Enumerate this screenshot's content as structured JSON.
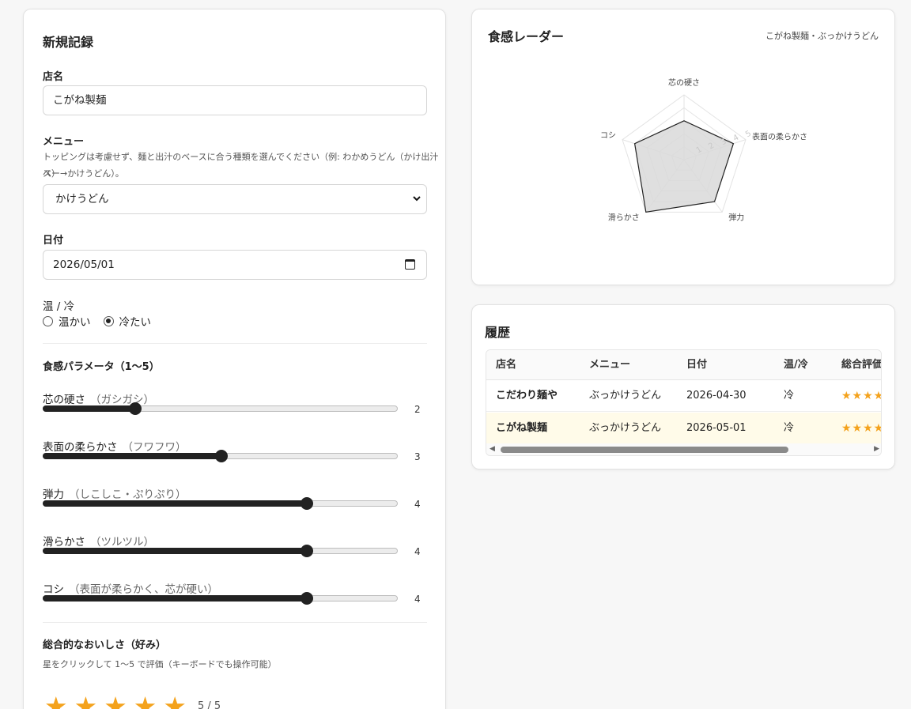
{
  "form": {
    "title": "新規記録",
    "shop_label": "店名",
    "shop_value": "こがね製麺",
    "menu_label": "メニュー",
    "menu_help_line1": "トッピングは考慮せず、麺と出汁のベースに合う種類を選んでください（例: わかめうどん（かけ出汁ベー",
    "menu_help_line2": "ス）→かけうどん）。",
    "menu_value": "かけうどん",
    "date_label": "日付",
    "date_value": "2026/05/01",
    "temp_label": "温 / 冷",
    "temp_options": [
      "温かい",
      "冷たい"
    ],
    "temp_selected": "冷たい",
    "texture_heading": "食感パラメータ（1〜5）",
    "sliders": [
      {
        "label": "芯の硬さ",
        "hint": "（ガシガシ）",
        "value": 2
      },
      {
        "label": "表面の柔らかさ",
        "hint": "（フワフワ）",
        "value": 3
      },
      {
        "label": "弾力",
        "hint": "（しこしこ・ぷりぷり）",
        "value": 4
      },
      {
        "label": "滑らかさ",
        "hint": "（ツルツル）",
        "value": 4
      },
      {
        "label": "コシ",
        "hint": "（表面が柔らかく、芯が硬い）",
        "value": 4
      }
    ],
    "slider_min": 1,
    "slider_max": 5,
    "overall_label": "総合的なおいしさ（好み）",
    "overall_help": "星をクリックして 1〜5 で評価（キーボードでも操作可能）",
    "rating": 5,
    "rating_text": "5 / 5"
  },
  "radar": {
    "title": "食感レーダー",
    "subtitle": "こがね製麺・ぶっかけうどん",
    "axes": [
      "芯の硬さ",
      "表面の柔らかさ",
      "弾力",
      "滑らかさ",
      "コシ"
    ],
    "values": [
      3,
      4,
      4,
      5,
      4
    ],
    "max": 5,
    "tick_labels": [
      "1",
      "2",
      "3",
      "4",
      "5"
    ],
    "fill_color": "#d9d9d9",
    "stroke_color": "#222222"
  },
  "history": {
    "title": "履歴",
    "columns": [
      "店名",
      "メニュー",
      "日付",
      "温/冷",
      "総合評価"
    ],
    "rows": [
      {
        "shop": "こだわり麺や",
        "menu": "ぶっかけうどん",
        "date": "2026-04-30",
        "temp": "冷",
        "stars": "★★★★"
      },
      {
        "shop": "こがね製麺",
        "menu": "ぶっかけうどん",
        "date": "2026-05-01",
        "temp": "冷",
        "stars": "★★★★"
      }
    ]
  },
  "colors": {
    "star": "#f4a21c",
    "highlight_row": "#fffbe9"
  }
}
